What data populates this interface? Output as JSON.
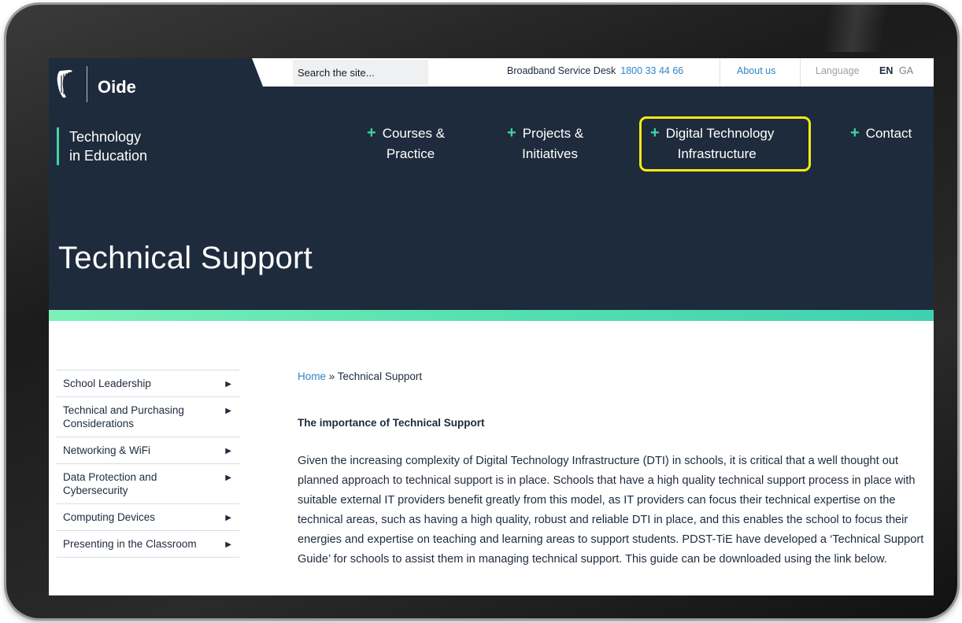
{
  "brand": {
    "name": "Oide",
    "subtitle_line1": "Technology",
    "subtitle_line2": "in Education"
  },
  "topbar": {
    "search_placeholder": "Search the site...",
    "service_desk_label": "Broadband Service Desk",
    "service_desk_phone": "1800 33 44 66",
    "about_label": "About us",
    "language_label": "Language",
    "lang_en": "EN",
    "lang_ga": "GA"
  },
  "nav": {
    "items": [
      {
        "line1": "Courses &",
        "line2": "Practice",
        "icon": "plus-icon"
      },
      {
        "line1": "Projects &",
        "line2": "Initiatives",
        "icon": "plus-icon"
      },
      {
        "line1": "Digital Technology",
        "line2": "Infrastructure",
        "icon": "plus-icon",
        "highlighted": true
      },
      {
        "line1": "Contact",
        "line2": "",
        "icon": "plus-icon"
      }
    ]
  },
  "page": {
    "title": "Technical Support"
  },
  "sidebar": {
    "items": [
      {
        "label": "School Leadership"
      },
      {
        "label": "Technical and Purchasing Considerations"
      },
      {
        "label": "Networking & WiFi"
      },
      {
        "label": "Data Protection and Cybersecurity"
      },
      {
        "label": "Computing Devices"
      },
      {
        "label": "Presenting in the Classroom"
      }
    ]
  },
  "breadcrumb": {
    "home": "Home",
    "separator": " » ",
    "current": "Technical Support"
  },
  "content": {
    "heading": "The importance of Technical Support",
    "paragraph": "Given the increasing complexity of Digital Technology Infrastructure (DTI) in schools, it is critical that a well thought out planned approach to technical support is in place. Schools that have a high quality technical support process in place with suitable external IT providers benefit greatly from this model, as IT providers can focus their technical expertise on the technical areas, such as having a high quality, robust and reliable DTI in place, and this enables the school to focus their energies and expertise on teaching and learning areas to support students. PDST-TiE have developed a ‘Technical Support Guide’ for schools to assist them in managing technical support. This guide can be downloaded using the link below."
  },
  "colors": {
    "header_bg": "#1e2b3c",
    "accent_green": "#3fd6a3",
    "link_blue": "#2e86c8",
    "highlight_yellow": "#f4ea16"
  }
}
